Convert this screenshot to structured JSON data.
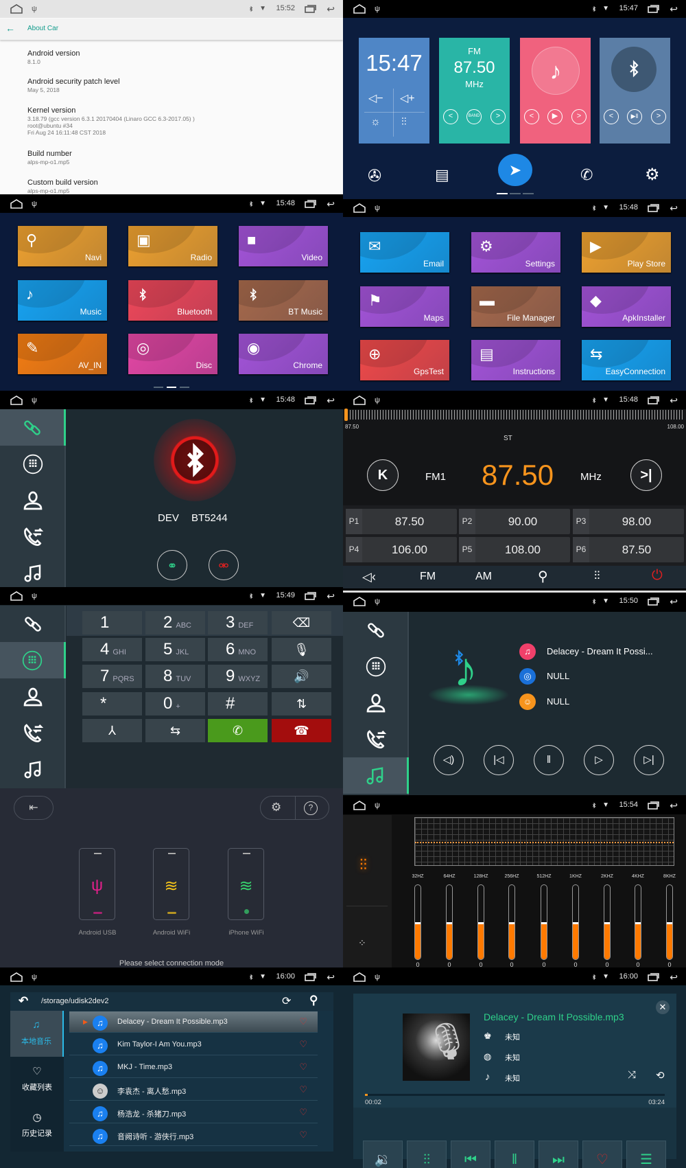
{
  "about_car": {
    "status_time": "15:52",
    "title": "About Car",
    "items": [
      {
        "label": "Android version",
        "value": "8.1.0"
      },
      {
        "label": "Android security patch level",
        "value": "May 5, 2018"
      },
      {
        "label": "Kernel version",
        "value": "3.18.79 (gcc version 6.3.1 20170404 (Linaro GCC 6.3-2017.05) )\nroot@ubuntu #34\nFri Aug 24 16:11:48 CST 2018"
      },
      {
        "label": "Build number",
        "value": "alps-mp-o1.mp5"
      },
      {
        "label": "Custom build version",
        "value": "alps-mp-o1.mp5"
      }
    ]
  },
  "home": {
    "status_time": "15:47",
    "clock": "15:47",
    "radio_band": "FM",
    "radio_freq": "87.50",
    "radio_unit": "MHz",
    "band_button": "BAND",
    "colors": {
      "background": "#0c1d3e",
      "clock_card": "#4f86c6",
      "radio_card": "#29b5a6",
      "music_card": "#f0627e",
      "bt_card": "#5b7ea6",
      "nav_button": "#1e88e5"
    },
    "dock_icons": [
      "video-icon",
      "radio-icon",
      "navigation-icon",
      "bt-phone-icon",
      "settings-icon"
    ],
    "page_indicator": {
      "pages": 3,
      "current": 1
    }
  },
  "apps_page1": {
    "status_time": "15:48",
    "page_indicator": {
      "pages": 3,
      "current": 2
    },
    "apps": [
      {
        "label": "Navi",
        "icon": "⚲",
        "color": "#eea12f"
      },
      {
        "label": "Radio",
        "icon": "▣",
        "color": "#eea12f"
      },
      {
        "label": "Video",
        "icon": "■",
        "color": "#a454d8"
      },
      {
        "label": "Music",
        "icon": "♪",
        "color": "#18a4f2"
      },
      {
        "label": "Bluetooth",
        "icon": "bt",
        "color": "#f0485a"
      },
      {
        "label": "BT Music",
        "icon": "bt",
        "color": "#a6694b"
      },
      {
        "label": "AV_IN",
        "icon": "✎",
        "color": "#f57d12"
      },
      {
        "label": "Disc",
        "icon": "◎",
        "color": "#e447a4"
      },
      {
        "label": "Chrome",
        "icon": "◉",
        "color": "#a454d8"
      }
    ]
  },
  "apps_page2": {
    "status_time": "15:48",
    "apps": [
      {
        "label": "Email",
        "icon": "✉",
        "color": "#18a4f2"
      },
      {
        "label": "Settings",
        "icon": "⚙",
        "color": "#a454d8"
      },
      {
        "label": "Play Store",
        "icon": "▶",
        "color": "#eea12f"
      },
      {
        "label": "Maps",
        "icon": "⚑",
        "color": "#a454d8"
      },
      {
        "label": "File Manager",
        "icon": "▬",
        "color": "#a6694b"
      },
      {
        "label": "ApkInstaller",
        "icon": "◆",
        "color": "#a454d8"
      },
      {
        "label": "GpsTest",
        "icon": "⊕",
        "color": "#f04a4a"
      },
      {
        "label": "Instructions",
        "icon": "▤",
        "color": "#a454d8"
      },
      {
        "label": "EasyConnection",
        "icon": "⇆",
        "color": "#18a4f2"
      }
    ]
  },
  "bt_connect": {
    "status_time": "15:48",
    "device_label": "DEV",
    "device_name": "BT5244",
    "sidebar_active": 0
  },
  "radio": {
    "status_time": "15:48",
    "range_min": "87.50",
    "range_max": "108.00",
    "stereo": "ST",
    "band": "FM1",
    "frequency": "87.50",
    "unit": "MHz",
    "tuner_position": 0,
    "presets": [
      {
        "label": "P1",
        "value": "87.50"
      },
      {
        "label": "P2",
        "value": "90.00"
      },
      {
        "label": "P3",
        "value": "98.00"
      },
      {
        "label": "P4",
        "value": "106.00"
      },
      {
        "label": "P5",
        "value": "108.00"
      },
      {
        "label": "P6",
        "value": "87.50"
      }
    ],
    "toolbar": {
      "fm": "FM",
      "am": "AM"
    },
    "colors": {
      "frequency": "#f7941d",
      "power": "#e02020"
    }
  },
  "dialer": {
    "status_time": "15:49",
    "sidebar_active": 1,
    "keys": [
      {
        "main": "1",
        "sub": ""
      },
      {
        "main": "2",
        "sub": "ABC"
      },
      {
        "main": "3",
        "sub": "DEF"
      },
      {
        "icon": "⌫",
        "name": "backspace"
      },
      {
        "main": "4",
        "sub": "GHI"
      },
      {
        "main": "5",
        "sub": "JKL"
      },
      {
        "main": "6",
        "sub": "MNO"
      },
      {
        "icon": "🎙",
        "name": "mute-mic"
      },
      {
        "main": "7",
        "sub": "PQRS"
      },
      {
        "main": "8",
        "sub": "TUV"
      },
      {
        "main": "9",
        "sub": "WXYZ"
      },
      {
        "icon": "🔊",
        "name": "speaker"
      },
      {
        "main": "*",
        "sub": ""
      },
      {
        "main": "0",
        "sub": "+"
      },
      {
        "main": "#",
        "sub": ""
      },
      {
        "icon": "⇅",
        "name": "transfer"
      },
      {
        "icon": "⅄",
        "name": "merge"
      },
      {
        "icon": "⇆",
        "name": "swap"
      },
      {
        "icon": "✆",
        "name": "call"
      },
      {
        "icon": "☎",
        "name": "hang-up"
      }
    ],
    "colors": {
      "call": "#4a9a1c",
      "hangup": "#a30d0d"
    }
  },
  "bt_music": {
    "status_time": "15:50",
    "sidebar_active": 4,
    "title": "Delacey - Dream It Possi...",
    "album": "NULL",
    "artist": "NULL"
  },
  "phone_link": {
    "options": [
      {
        "label": "Android USB",
        "icon": "ψ",
        "color": "#e0208a"
      },
      {
        "label": "Android WiFi",
        "icon": "≋",
        "color": "#f2c21b"
      },
      {
        "label": "iPhone WiFi",
        "icon": "≋",
        "color": "#37d06d"
      }
    ],
    "prompt": "Please select connection mode"
  },
  "equalizer": {
    "status_time": "15:54",
    "bands": [
      {
        "label": "32HZ",
        "value": 0
      },
      {
        "label": "64HZ",
        "value": 0
      },
      {
        "label": "128HZ",
        "value": 0
      },
      {
        "label": "256HZ",
        "value": 0
      },
      {
        "label": "512HZ",
        "value": 0
      },
      {
        "label": "1KHZ",
        "value": 0
      },
      {
        "label": "2KHZ",
        "value": 0
      },
      {
        "label": "4KHZ",
        "value": 0
      },
      {
        "label": "8KHZ",
        "value": 0
      }
    ],
    "level_fraction": 0.5,
    "colors": {
      "accent": "#ff7a00"
    }
  },
  "music_list": {
    "status_time": "16:00",
    "path": "/storage/udisk2dev2",
    "nav": [
      {
        "label": "本地音乐",
        "icon": "♫"
      },
      {
        "label": "收藏列表",
        "icon": "♡"
      },
      {
        "label": "历史记录",
        "icon": "◷"
      }
    ],
    "songs": [
      {
        "title": "Delacey - Dream It Possible.mp3",
        "playing": true
      },
      {
        "title": "Kim Taylor-I Am You.mp3"
      },
      {
        "title": "MKJ - Time.mp3"
      },
      {
        "title": "李袁杰 - 离人愁.mp3",
        "avatar": true
      },
      {
        "title": "杨浩龙 - 杀猪刀.mp3"
      },
      {
        "title": "音阙诗听 - 游侠行.mp3"
      }
    ]
  },
  "player": {
    "status_time": "16:00",
    "title": "Delacey - Dream It Possible.mp3",
    "artist": "未知",
    "album": "未知",
    "genre": "未知",
    "elapsed": "00:02",
    "total": "03:24",
    "progress": 0.01,
    "colors": {
      "accent": "#2fd18a",
      "favorite": "#d02a2a"
    }
  }
}
